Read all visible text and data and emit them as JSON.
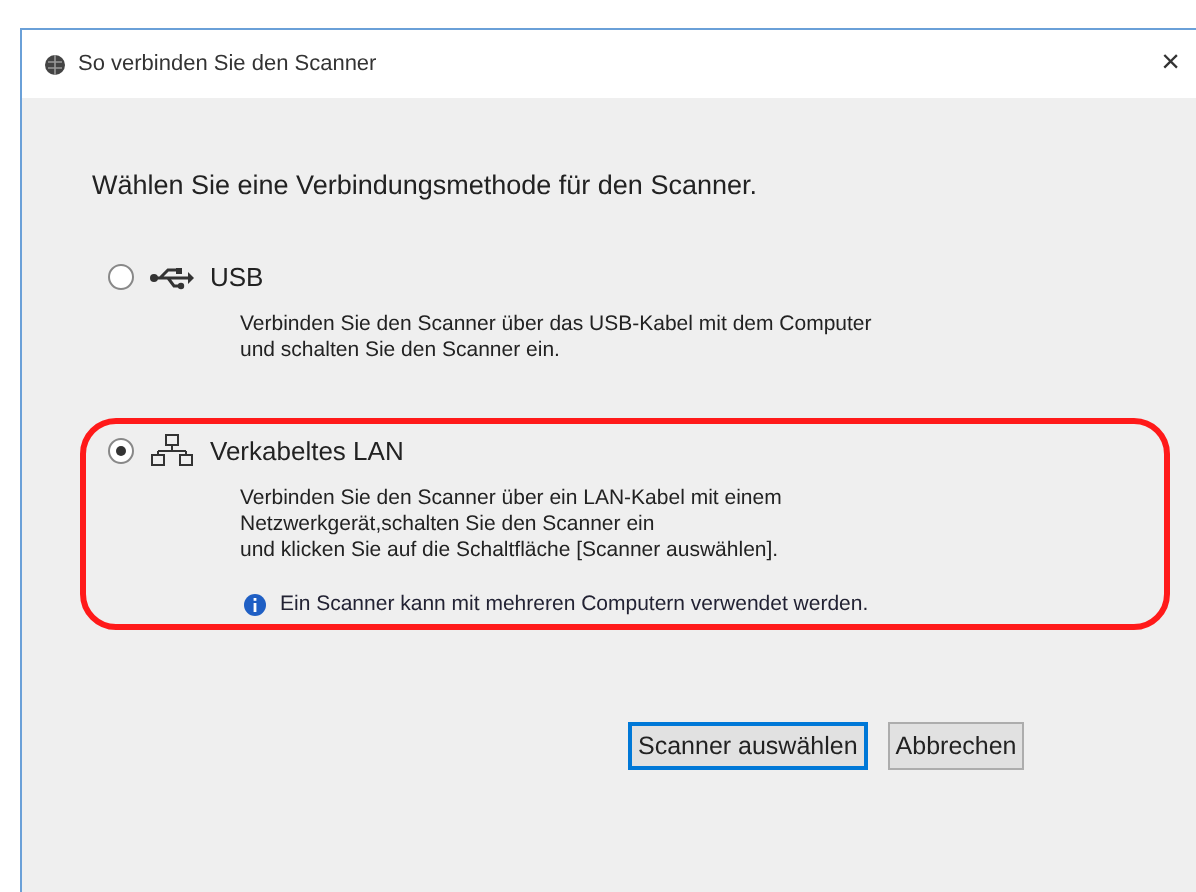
{
  "window": {
    "title": "So verbinden Sie den Scanner",
    "close": "×"
  },
  "prompt": "Wählen Sie eine Verbindungsmethode für den Scanner.",
  "options": [
    {
      "kind": "usb",
      "label": "USB",
      "selected": false,
      "highlighted": false,
      "description": [
        "Verbinden Sie den Scanner über das USB-Kabel mit dem Computer",
        "und schalten Sie den Scanner ein."
      ]
    },
    {
      "kind": "lan",
      "label": "Verkabeltes LAN",
      "selected": true,
      "highlighted": true,
      "description": [
        "Verbinden Sie den Scanner über ein LAN-Kabel mit einem",
        "Netzwerkgerät,schalten Sie den Scanner ein",
        "und klicken Sie auf die Schaltfläche [Scanner auswählen]."
      ],
      "note": "Ein Scanner kann mit mehreren Computern verwendet werden."
    }
  ],
  "buttons": [
    {
      "label": "Scanner auswählen",
      "focused": true
    },
    {
      "label": "Abbrechen",
      "focused": false
    }
  ]
}
